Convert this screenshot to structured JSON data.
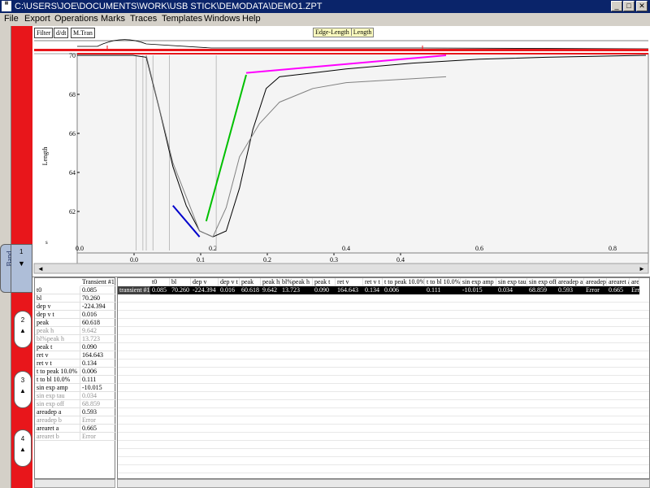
{
  "window": {
    "title": "C:\\USERS\\JOE\\DOCUMENTS\\WORK\\USB STICK\\DEMODATA\\DEMO1.ZPT",
    "min_btn": "_",
    "max_btn": "□",
    "close_btn": "✕"
  },
  "menu": {
    "items": [
      "File",
      "Export",
      "Operations",
      "Marks",
      "Traces",
      "Templates",
      "Windows",
      "Help"
    ]
  },
  "sidebar": {
    "band_label": "Band",
    "tabs": [
      {
        "label": "1",
        "arrow": "▼"
      },
      {
        "label": "2",
        "arrow": "▲"
      },
      {
        "label": "3",
        "arrow": "▲"
      },
      {
        "label": "4",
        "arrow": "▲"
      }
    ]
  },
  "chart_toolbar": {
    "filter": "Filter",
    "ddt": "d/dt",
    "mtran": "M.Tran",
    "legend_a": "Edge-Length",
    "legend_b": "Length"
  },
  "chart_data": {
    "type": "line",
    "ylabel": "Length",
    "ylim": [
      60,
      70
    ],
    "xlim": [
      0,
      0.85
    ],
    "yticks": [
      "70",
      "68",
      "66",
      "64",
      "62"
    ],
    "upper_xticks": [
      "0.0",
      "0.2",
      "0.4",
      "0.6",
      "0.8"
    ],
    "lower_xticks": [
      "0.0",
      "0.1",
      "0.2",
      "0.3",
      "0.4"
    ],
    "corner_label": "s",
    "grid": false,
    "series": [
      {
        "color": "#000000",
        "x": [
          0.0,
          0.08,
          0.1,
          0.12,
          0.14,
          0.16,
          0.18,
          0.2,
          0.22,
          0.24,
          0.26,
          0.28,
          0.3,
          0.4,
          0.5,
          0.6,
          0.7,
          0.85
        ],
        "y": [
          70.0,
          70.0,
          69.9,
          67.2,
          64.3,
          62.3,
          61.0,
          60.7,
          61.0,
          63.2,
          66.2,
          68.3,
          68.9,
          69.3,
          69.6,
          69.8,
          69.9,
          70.0
        ]
      },
      {
        "color": "#808080",
        "x": [
          0.1,
          0.14,
          0.18,
          0.2,
          0.22,
          0.24,
          0.27,
          0.3,
          0.35,
          0.4,
          0.5,
          0.55
        ],
        "y": [
          70.0,
          64.5,
          61.0,
          60.7,
          62.2,
          64.8,
          66.5,
          67.6,
          68.3,
          68.6,
          68.8,
          68.9
        ]
      },
      {
        "color": "#ff00ff",
        "x": [
          0.25,
          0.55
        ],
        "y": [
          69.1,
          70.0
        ]
      },
      {
        "color": "#00c000",
        "x": [
          0.19,
          0.25
        ],
        "y": [
          61.5,
          69.0
        ]
      },
      {
        "color": "#0000cc",
        "x": [
          0.14,
          0.18
        ],
        "y": [
          62.3,
          60.7
        ]
      }
    ]
  },
  "transient": {
    "column_header": "Transient #1",
    "row_label": "transient #1",
    "rows": [
      {
        "name": "t0",
        "value": "0.085",
        "grey": false
      },
      {
        "name": "bl",
        "value": "70.260",
        "grey": false
      },
      {
        "name": "dep v",
        "value": "-224.394",
        "grey": false
      },
      {
        "name": "dep v t",
        "value": "0.016",
        "grey": false
      },
      {
        "name": "peak",
        "value": "60.618",
        "grey": false
      },
      {
        "name": "peak h",
        "value": "9.642",
        "grey": true
      },
      {
        "name": "bl%peak h",
        "value": "13.723",
        "grey": true
      },
      {
        "name": "peak t",
        "value": "0.090",
        "grey": false
      },
      {
        "name": "ret v",
        "value": "164.643",
        "grey": false
      },
      {
        "name": "ret v t",
        "value": "0.134",
        "grey": false
      },
      {
        "name": "t to peak 10.0%",
        "value": "0.006",
        "grey": false
      },
      {
        "name": "t to bl 10.0%",
        "value": "0.111",
        "grey": false
      },
      {
        "name": "sin exp amp",
        "value": "-10.015",
        "grey": false
      },
      {
        "name": "sin exp tau",
        "value": "0.034",
        "grey": true
      },
      {
        "name": "sin exp off",
        "value": "68.859",
        "grey": true
      },
      {
        "name": "areadep a",
        "value": "0.593",
        "grey": false
      },
      {
        "name": "areadep b",
        "value": "Error",
        "grey": true
      },
      {
        "name": "arearet a",
        "value": "0.665",
        "grey": false
      },
      {
        "name": "arearet b",
        "value": "Error",
        "grey": true
      }
    ],
    "wide_headers": [
      "t0",
      "bl",
      "dep v",
      "dep v t",
      "peak",
      "peak h",
      "bl%peak h",
      "peak t",
      "ret v",
      "ret v t",
      "t to peak 10.0%",
      "t to bl 10.0%",
      "sin exp amp",
      "sin exp tau",
      "sin exp off",
      "areadep a",
      "areadep b",
      "arearet a",
      "arearet b"
    ],
    "wide_values": [
      "0.085",
      "70.260",
      "-224.394",
      "0.016",
      "60.618",
      "9.642",
      "13.723",
      "0.090",
      "164.643",
      "0.134",
      "0.006",
      "0.111",
      "-10.015",
      "0.034",
      "68.859",
      "0.593",
      "Error",
      "0.665",
      "Error"
    ]
  }
}
